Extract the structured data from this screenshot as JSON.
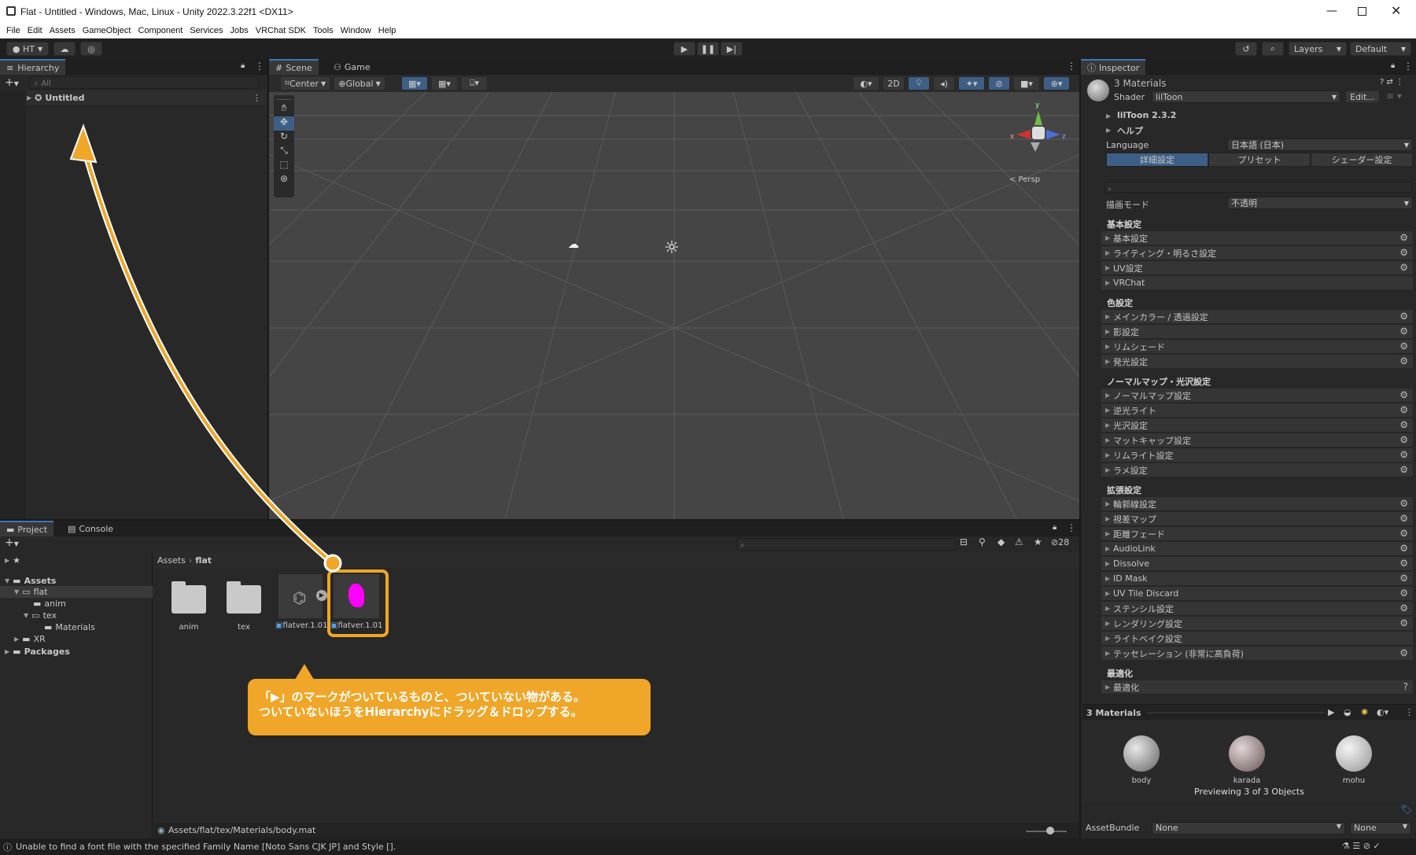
{
  "window": {
    "title": "Flat - Untitled - Windows, Mac, Linux - Unity 2022.3.22f1 <DX11>"
  },
  "menu": [
    "File",
    "Edit",
    "Assets",
    "GameObject",
    "Component",
    "Services",
    "Jobs",
    "VRChat SDK",
    "Tools",
    "Window",
    "Help"
  ],
  "toolbar": {
    "account": "HT",
    "layers": "Layers",
    "layout": "Default"
  },
  "hierarchy": {
    "tab": "Hierarchy",
    "search_placeholder": "All",
    "scene": "Untitled"
  },
  "scene_view": {
    "tabs": [
      "Scene",
      "Game"
    ],
    "pivot": "Center",
    "space": "Global",
    "mode_2d": "2D",
    "persp": "< Persp",
    "axis": {
      "x": "x",
      "y": "y",
      "z": "z"
    }
  },
  "project": {
    "tabs": [
      "Project",
      "Console"
    ],
    "hidden_count": "28",
    "favorites": "Favorites",
    "tree": {
      "assets": "Assets",
      "flat": "flat",
      "anim": "anim",
      "tex": "tex",
      "materials": "Materials",
      "xr": "XR",
      "packages": "Packages"
    },
    "breadcrumb": [
      "Assets",
      "flat"
    ],
    "items": [
      {
        "label": "anim",
        "type": "folder"
      },
      {
        "label": "tex",
        "type": "folder"
      },
      {
        "label": "flatver.1.01",
        "type": "model-prefab"
      },
      {
        "label": "flatver.1.01",
        "type": "model"
      }
    ],
    "status_path": "Assets/flat/tex/Materials/body.mat"
  },
  "callout": {
    "line1": "「▶」のマークがついているものと、ついていない物がある。",
    "line2": "ついていないほうをHierarchyにドラッグ＆ドロップする。",
    "color": "#f0a628"
  },
  "inspector": {
    "tab": "Inspector",
    "title": "3 Materials",
    "shader_label": "Shader",
    "shader": "lilToon",
    "edit": "Edit...",
    "version": "lilToon 2.3.2",
    "help": "ヘルプ",
    "language_label": "Language",
    "language": "日本語 (日本)",
    "mode_tabs": [
      "詳細設定",
      "プリセット",
      "シェーダー設定"
    ],
    "render_mode_label": "描画モード",
    "render_mode": "不透明",
    "sections": [
      {
        "title": "基本設定",
        "rows": [
          "基本設定",
          "ライティング・明るさ設定",
          "UV設定",
          "VRChat"
        ]
      },
      {
        "title": "色設定",
        "rows": [
          "メインカラー / 透過設定",
          "影設定",
          "リムシェード",
          "発光設定"
        ]
      },
      {
        "title": "ノーマルマップ・光沢設定",
        "rows": [
          "ノーマルマップ設定",
          "逆光ライト",
          "光沢設定",
          "マットキャップ設定",
          "リムライト設定",
          "ラメ設定"
        ]
      },
      {
        "title": "拡張設定",
        "rows": [
          "輪郭線設定",
          "視差マップ",
          "距離フェード",
          "AudioLink",
          "Dissolve",
          "ID Mask",
          "UV Tile Discard",
          "ステンシル設定",
          "レンダリング設定",
          "ライトベイク設定",
          "テッセレーション (非常に高負荷)"
        ]
      },
      {
        "title": "最適化",
        "rows": [
          "最適化"
        ]
      }
    ],
    "preview_title": "3 Materials",
    "previews": [
      "body",
      "karada",
      "mohu"
    ],
    "previewing": "Previewing 3 of 3 Objects",
    "assetbundle_label": "AssetBundle",
    "assetbundle": "None",
    "variant": "None"
  },
  "statusbar": {
    "message": "Unable to find a font file with the specified Family Name [Noto Sans CJK JP] and Style []."
  }
}
